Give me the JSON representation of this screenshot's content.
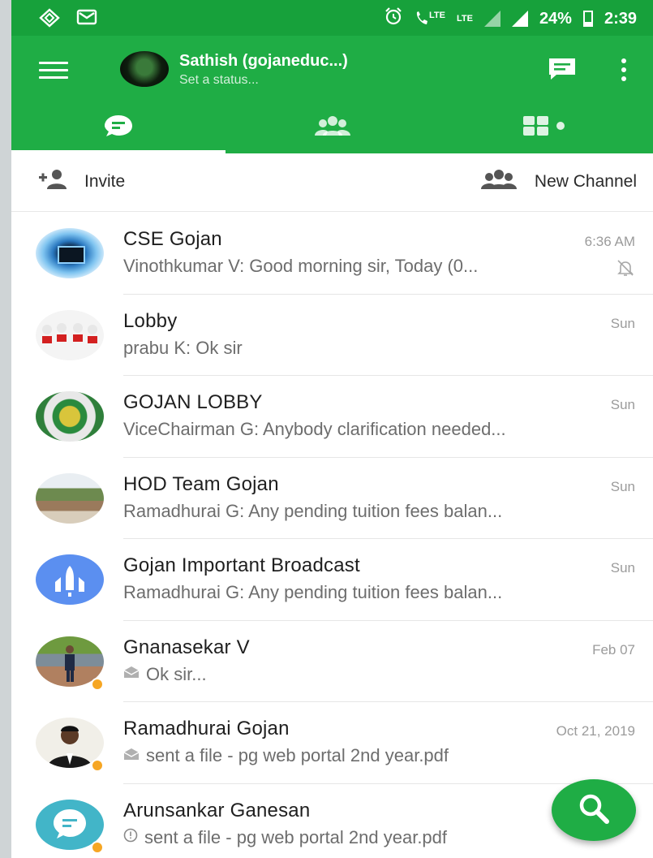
{
  "status_bar": {
    "lte_label": "LTE",
    "lte2_label": "LTE",
    "battery": "24%",
    "time": "2:39",
    "icons": [
      "app-icon",
      "mail-icon",
      "alarm-icon",
      "volte-call-icon",
      "signal-icon",
      "battery-icon"
    ]
  },
  "header": {
    "user_name": "Sathish (gojaneduc...)",
    "user_status": "Set a status..."
  },
  "tabs": [
    {
      "icon": "chat-icon",
      "active": true
    },
    {
      "icon": "people-icon",
      "active": false
    },
    {
      "icon": "apps-icon",
      "active": false
    }
  ],
  "actions": {
    "invite": "Invite",
    "new_channel": "New Channel"
  },
  "conversations": [
    {
      "title": "CSE Gojan",
      "time": "6:36 AM",
      "preview": "Vinothkumar V: Good morning sir, Today (0...",
      "muted": true
    },
    {
      "title": "Lobby",
      "time": "Sun",
      "preview": "prabu K: Ok sir"
    },
    {
      "title": "GOJAN LOBBY",
      "time": "Sun",
      "preview": "ViceChairman G: Anybody clarification needed..."
    },
    {
      "title": "HOD Team Gojan",
      "time": "Sun",
      "preview": "Ramadhurai G: Any pending tuition fees balan..."
    },
    {
      "title": "Gojan Important Broadcast",
      "time": "Sun",
      "preview": "Ramadhurai G: Any pending tuition fees balan..."
    },
    {
      "title": "Gnanasekar V",
      "time": "Feb 07",
      "preview": "Ok sir...",
      "status_dot": true
    },
    {
      "title": "Ramadhurai Gojan",
      "time": "Oct 21, 2019",
      "preview": "sent a file - pg web portal 2nd year.pdf",
      "status_dot": true
    },
    {
      "title": "Arunsankar Ganesan",
      "time": "Oc",
      "preview": "sent a file - pg web portal 2nd year.pdf",
      "status_dot": true
    }
  ],
  "colors": {
    "status_bar": "#17a13b",
    "app_bar": "#1fad45",
    "away_dot": "#f6a623"
  }
}
